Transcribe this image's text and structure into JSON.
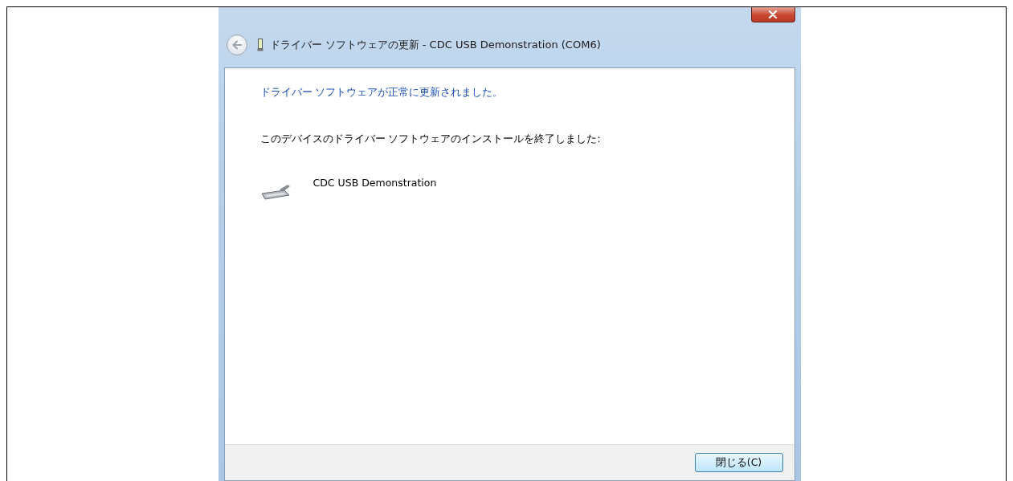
{
  "window": {
    "title": "ドライバー ソフトウェアの更新 - CDC USB Demonstration (COM6)"
  },
  "heading": "ドライバー ソフトウェアが正常に更新されました。",
  "message": "このデバイスのドライバー ソフトウェアのインストールを終了しました:",
  "device": {
    "name": "CDC USB Demonstration"
  },
  "buttons": [
    {
      "label": "閉じる(C)"
    }
  ]
}
